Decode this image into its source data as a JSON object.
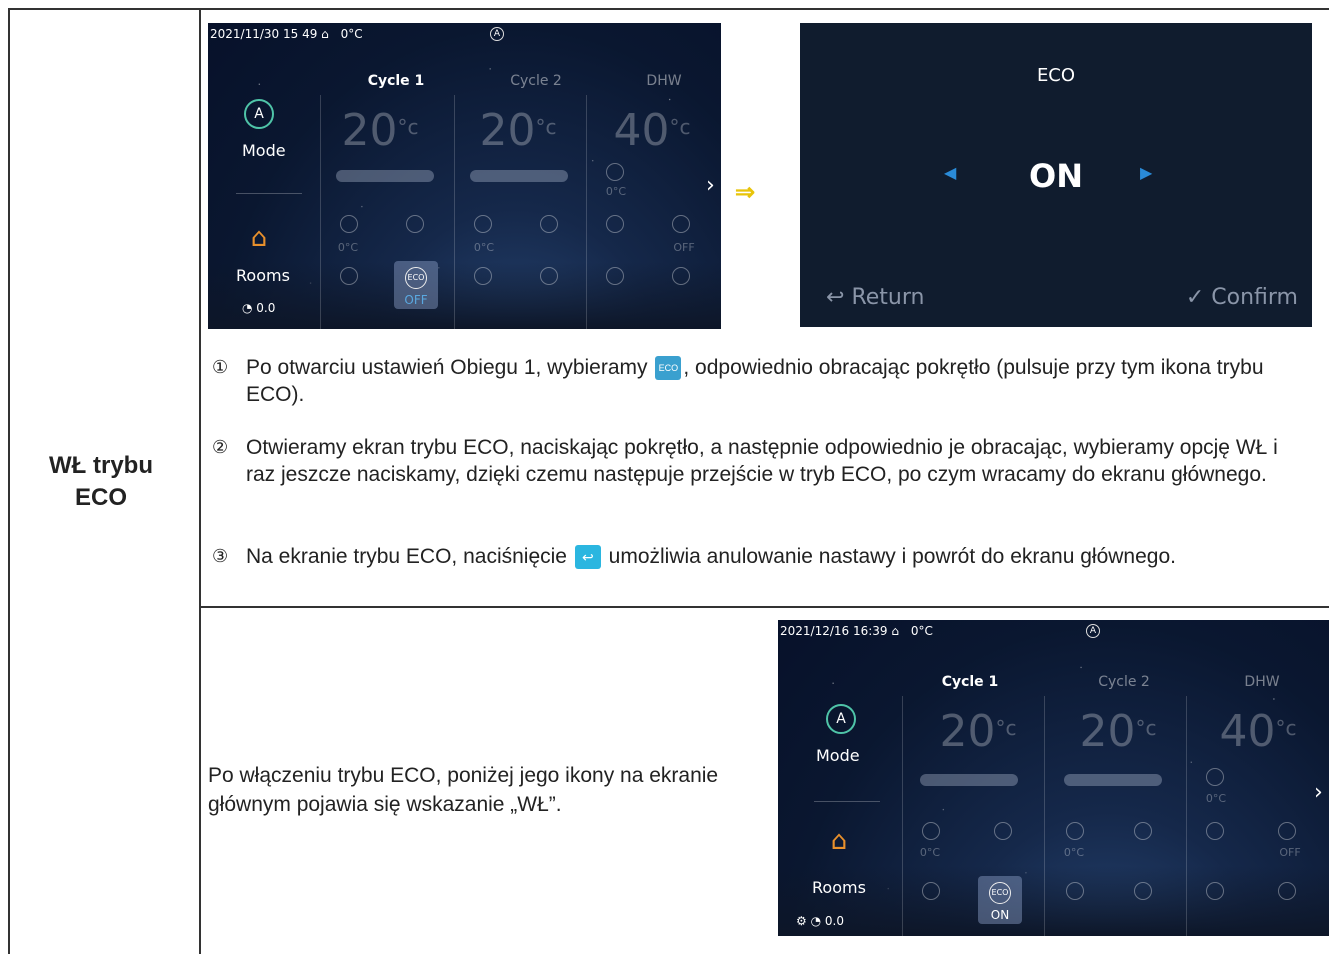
{
  "row_label": [
    "WŁ trybu",
    "ECO"
  ],
  "screen1": {
    "datetime": "2021/11/30 15 49",
    "outdoor_temp": "0°C",
    "auto_badge": "A",
    "cycle1": "Cycle 1",
    "cycle2": "Cycle 2",
    "dhw": "DHW",
    "temp1": "20",
    "temp2": "20",
    "temp3": "40",
    "unit": "°c",
    "mode_label": "Mode",
    "rooms_label": "Rooms",
    "meter": "0.0",
    "eco_state": "OFF",
    "small_0c": "0°C",
    "small_off": "OFF"
  },
  "eco_screen": {
    "title": "ECO",
    "value": "ON",
    "return": "Return",
    "confirm": "Confirm"
  },
  "steps": [
    {
      "num": "1",
      "before": "Po otwarciu ustawień Obiegu 1, wybieramy ",
      "after": ", odpowiednio obracając pokrętło (pulsuje przy tym ikona trybu ECO)."
    },
    {
      "num": "2",
      "text": "Otwieramy ekran trybu ECO, naciskając pokrętło, a następnie odpowiednio je obracając, wybieramy opcję WŁ i raz jeszcze naciskamy, dzięki czemu następuje przejście w tryb ECO, po czym wracamy do ekranu głównego."
    },
    {
      "num": "3",
      "before": "Na ekranie trybu ECO, naciśnięcie ",
      "after": " umożliwia anulowanie nastawy i powrót do ekranu głównego."
    }
  ],
  "note": "Po włączeniu trybu ECO, poniżej jego ikony na ekranie głównym pojawia się wskazanie „WŁ”.",
  "screen2": {
    "datetime": "2021/12/16 16:39",
    "outdoor_temp": "0°C",
    "auto_badge": "A",
    "cycle1": "Cycle 1",
    "cycle2": "Cycle 2",
    "dhw": "DHW",
    "temp1": "20",
    "temp2": "20",
    "temp3": "40",
    "unit": "°c",
    "mode_label": "Mode",
    "rooms_label": "Rooms",
    "meter": "0.0",
    "eco_state": "ON",
    "small_0c": "0°C",
    "small_off": "OFF"
  }
}
